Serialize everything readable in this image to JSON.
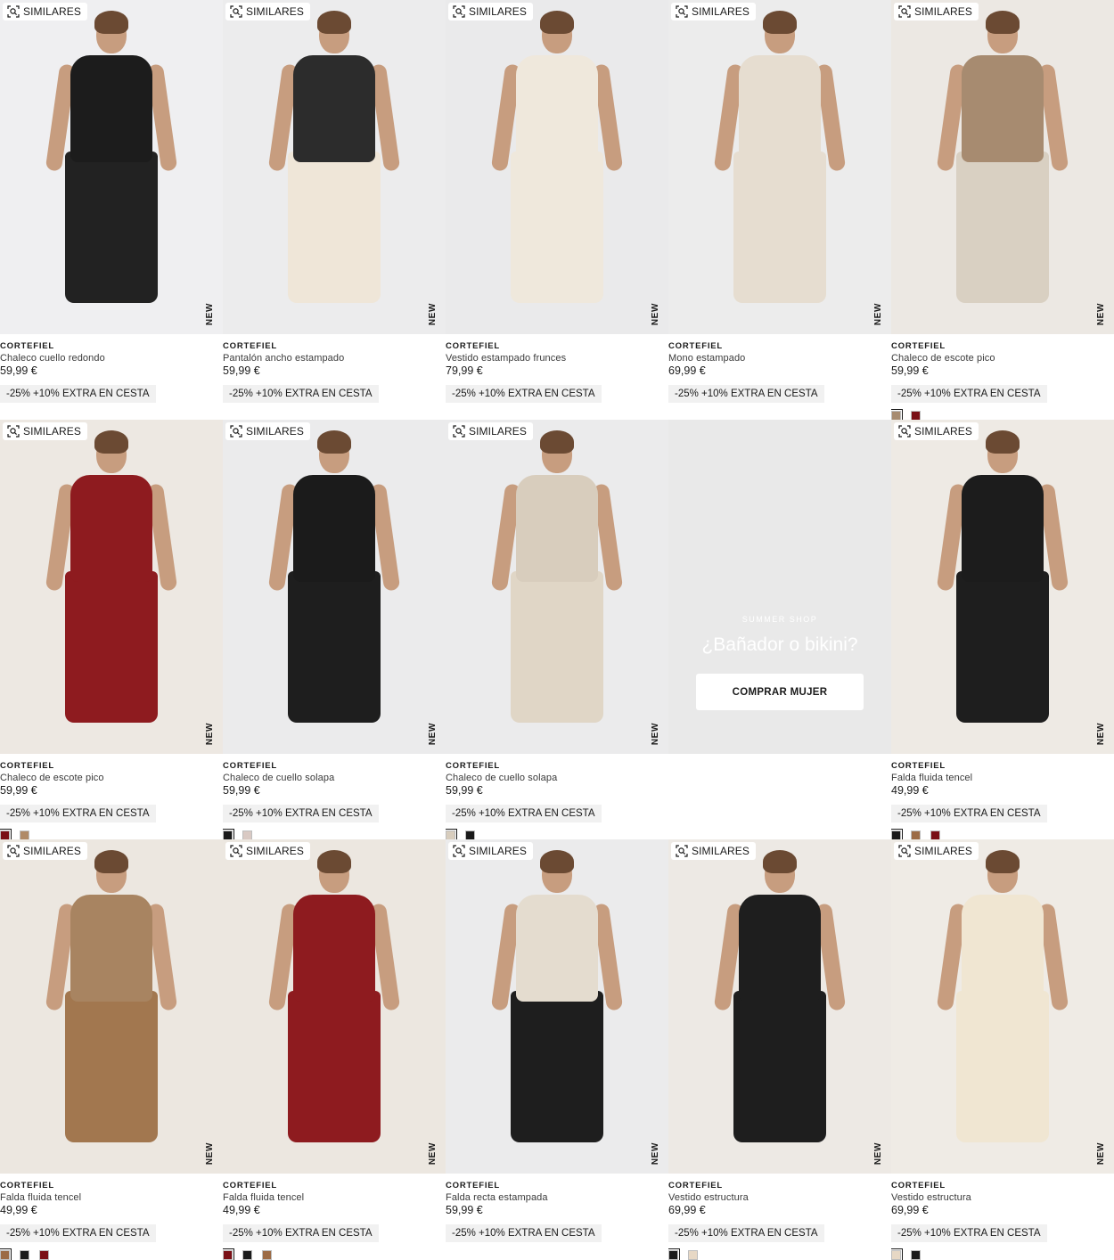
{
  "labels": {
    "similar": "SIMILARES",
    "new": "NEW"
  },
  "promo_banner": {
    "eyebrow": "SUMMER SHOP",
    "title": "¿Bañador o bikini?",
    "button": "COMPRAR MUJER"
  },
  "products": [
    {
      "brand": "CORTEFIEL",
      "name": "Chaleco cuello redondo",
      "price": "59,99 €",
      "promo": "-25% +10% EXTRA EN CESTA",
      "bg": "#efeff1",
      "top": "#1c1c1c",
      "bottom": "#222222",
      "swatches": []
    },
    {
      "brand": "CORTEFIEL",
      "name": "Pantalón ancho estampado",
      "price": "59,99 €",
      "promo": "-25% +10% EXTRA EN CESTA",
      "bg": "#ececed",
      "top": "#2c2c2c",
      "bottom": "#efe6d8",
      "swatches": []
    },
    {
      "brand": "CORTEFIEL",
      "name": "Vestido estampado frunces",
      "price": "79,99 €",
      "promo": "-25% +10% EXTRA EN CESTA",
      "bg": "#eaeaeb",
      "top": "#efe8dc",
      "bottom": "#efe8dc",
      "swatches": []
    },
    {
      "brand": "CORTEFIEL",
      "name": "Mono estampado",
      "price": "69,99 €",
      "promo": "-25% +10% EXTRA EN CESTA",
      "bg": "#ececec",
      "top": "#e6ddd0",
      "bottom": "#e6ddd0",
      "swatches": []
    },
    {
      "brand": "CORTEFIEL",
      "name": "Chaleco de escote pico",
      "price": "59,99 €",
      "promo": "-25% +10% EXTRA EN CESTA",
      "bg": "#ece8e3",
      "top": "#a78b70",
      "bottom": "#d9d0c2",
      "swatches": [
        "#a78b70",
        "#7a1016"
      ]
    },
    {
      "brand": "CORTEFIEL",
      "name": "Chaleco de escote pico",
      "price": "59,99 €",
      "promo": "-25% +10% EXTRA EN CESTA",
      "bg": "#ede8e2",
      "top": "#8e1b1f",
      "bottom": "#8e1b1f",
      "swatches": [
        "#7a1016",
        "#b08a67"
      ]
    },
    {
      "brand": "CORTEFIEL",
      "name": "Chaleco de cuello solapa",
      "price": "59,99 €",
      "promo": "-25% +10% EXTRA EN CESTA",
      "bg": "#ebebec",
      "top": "#1b1b1b",
      "bottom": "#1e1e1e",
      "swatches": [
        "#1a1a1a",
        "#d9c9c3"
      ]
    },
    {
      "brand": "CORTEFIEL",
      "name": "Chaleco de cuello solapa",
      "price": "59,99 €",
      "promo": "-25% +10% EXTRA EN CESTA",
      "bg": "#ebebec",
      "top": "#d8cdbd",
      "bottom": "#e0d6c6",
      "swatches": [
        "#d8cdbd",
        "#1a1a1a"
      ]
    },
    {
      "brand": "CORTEFIEL",
      "name": "Falda fluida tencel",
      "price": "49,99 €",
      "promo": "-25% +10% EXTRA EN CESTA",
      "bg": "#eeeae4",
      "top": "#1c1c1c",
      "bottom": "#1e1e1e",
      "swatches": [
        "#1a1a1a",
        "#9c6b45",
        "#7a1016"
      ]
    },
    {
      "brand": "CORTEFIEL",
      "name": "Falda fluida tencel",
      "price": "49,99 €",
      "promo": "-25% +10% EXTRA EN CESTA",
      "bg": "#ece7e0",
      "top": "#a88461",
      "bottom": "#a2774f",
      "swatches": [
        "#9c6b45",
        "#1a1a1a",
        "#7a1016"
      ]
    },
    {
      "brand": "CORTEFIEL",
      "name": "Falda fluida tencel",
      "price": "49,99 €",
      "promo": "-25% +10% EXTRA EN CESTA",
      "bg": "#ece7e0",
      "top": "#8e1b1f",
      "bottom": "#8e1b1f",
      "swatches": [
        "#7a1016",
        "#1a1a1a",
        "#9c6b45"
      ]
    },
    {
      "brand": "CORTEFIEL",
      "name": "Falda recta estampada",
      "price": "59,99 €",
      "promo": "-25% +10% EXTRA EN CESTA",
      "bg": "#ebebec",
      "top": "#e4dccf",
      "bottom": "#1e1e1e",
      "swatches": []
    },
    {
      "brand": "CORTEFIEL",
      "name": "Vestido estructura",
      "price": "69,99 €",
      "promo": "-25% +10% EXTRA EN CESTA",
      "bg": "#ede9e4",
      "top": "#1e1e1e",
      "bottom": "#1e1e1e",
      "swatches": [
        "#1a1a1a",
        "#e7d8c5"
      ]
    },
    {
      "brand": "CORTEFIEL",
      "name": "Vestido estructura",
      "price": "69,99 €",
      "promo": "-25% +10% EXTRA EN CESTA",
      "bg": "#efebe5",
      "top": "#f0e6d2",
      "bottom": "#f0e6d2",
      "swatches": [
        "#e7d8c5",
        "#1a1a1a"
      ]
    }
  ]
}
